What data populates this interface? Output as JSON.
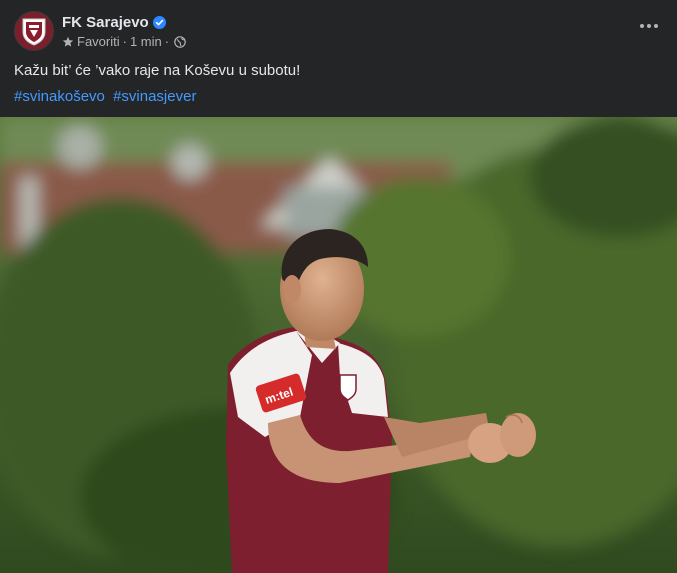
{
  "post": {
    "page_name": "FK Sarajevo",
    "audience_label": "Favoriti",
    "separator": "·",
    "timestamp": "1 min",
    "verified_icon": "verified-badge-icon",
    "body_text": "Kažu bit’ će ’vako raje na Koševu u subotu!",
    "hashtags": [
      "#svinakoševo",
      "#svinasjever"
    ]
  },
  "photo": {
    "jersey_sponsor": "m:tel"
  },
  "colors": {
    "background": "#242526",
    "primary_text": "#e4e6eb",
    "secondary_text": "#b0b3b8",
    "link": "#4599ff",
    "verified": "#2d88ff",
    "club_maroon": "#7a1f2b"
  }
}
